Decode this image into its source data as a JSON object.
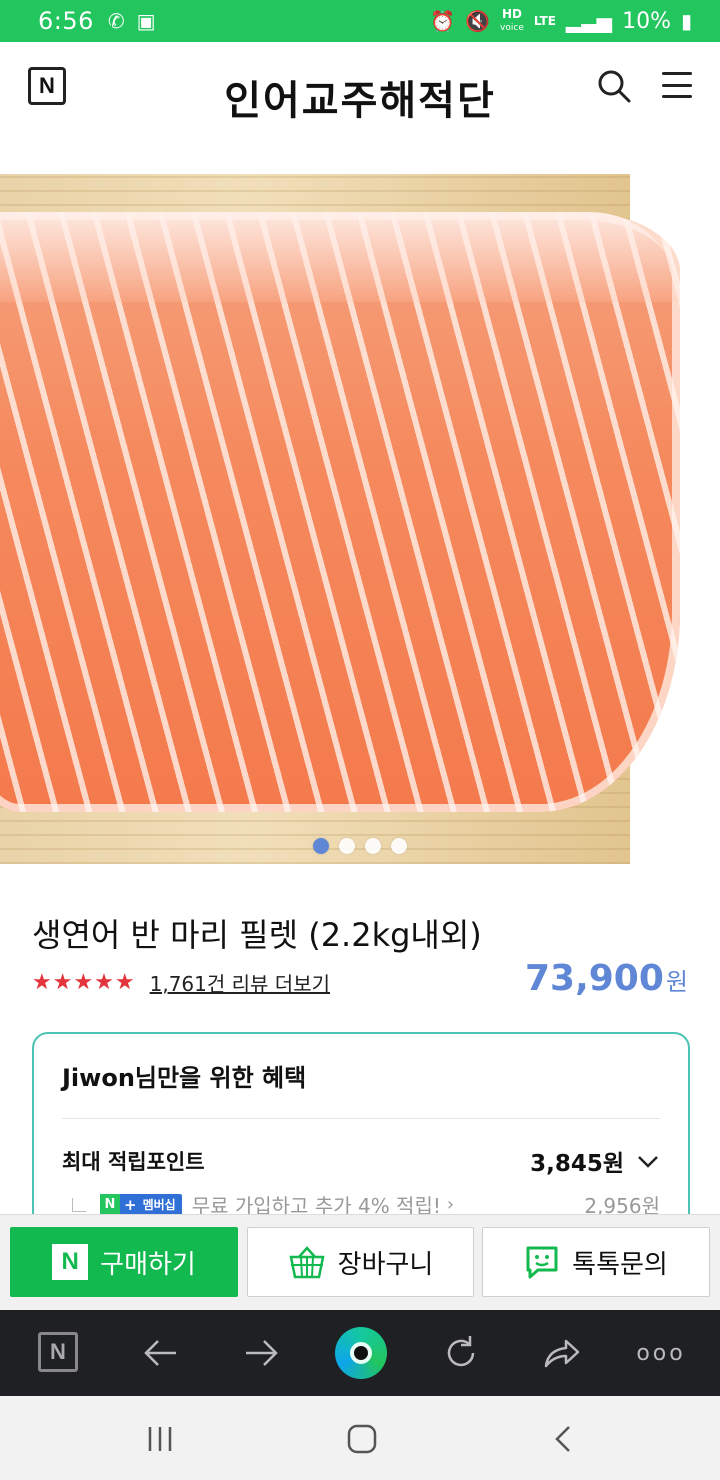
{
  "status": {
    "time": "6:56",
    "hd": "HD",
    "voice": "voice",
    "lte": "LTE",
    "battery": "10%"
  },
  "header": {
    "logo": "N",
    "store_name": "인어교주해적단"
  },
  "product": {
    "title": "생연어 반 마리 필렛 (2.2kg내외)",
    "stars": "★★★★★",
    "review_link": "1,761건 리뷰 더보기",
    "price": "73,900",
    "price_unit": "원",
    "carousel": {
      "count": 4,
      "active_index": 0
    }
  },
  "benefits": {
    "title": "Jiwon님만을 위한 혜택",
    "point_label": "최대 적립포인트",
    "point_value": "3,845원",
    "badge_n": "N",
    "badge_plus": "+",
    "badge_label": "멤버십",
    "member_text": "무료 가입하고 추가 4% 적립!",
    "member_value": "2,956원"
  },
  "actions": {
    "buy": "구매하기",
    "buy_logo": "N",
    "cart": "장바구니",
    "talk": "톡톡문의"
  },
  "browser": {
    "home_logo": "N",
    "more": "ooo"
  },
  "colors": {
    "status_green": "#22c55e",
    "price_blue": "#5f87d6",
    "buy_green": "#12b94f",
    "star_red": "#e3353c"
  }
}
